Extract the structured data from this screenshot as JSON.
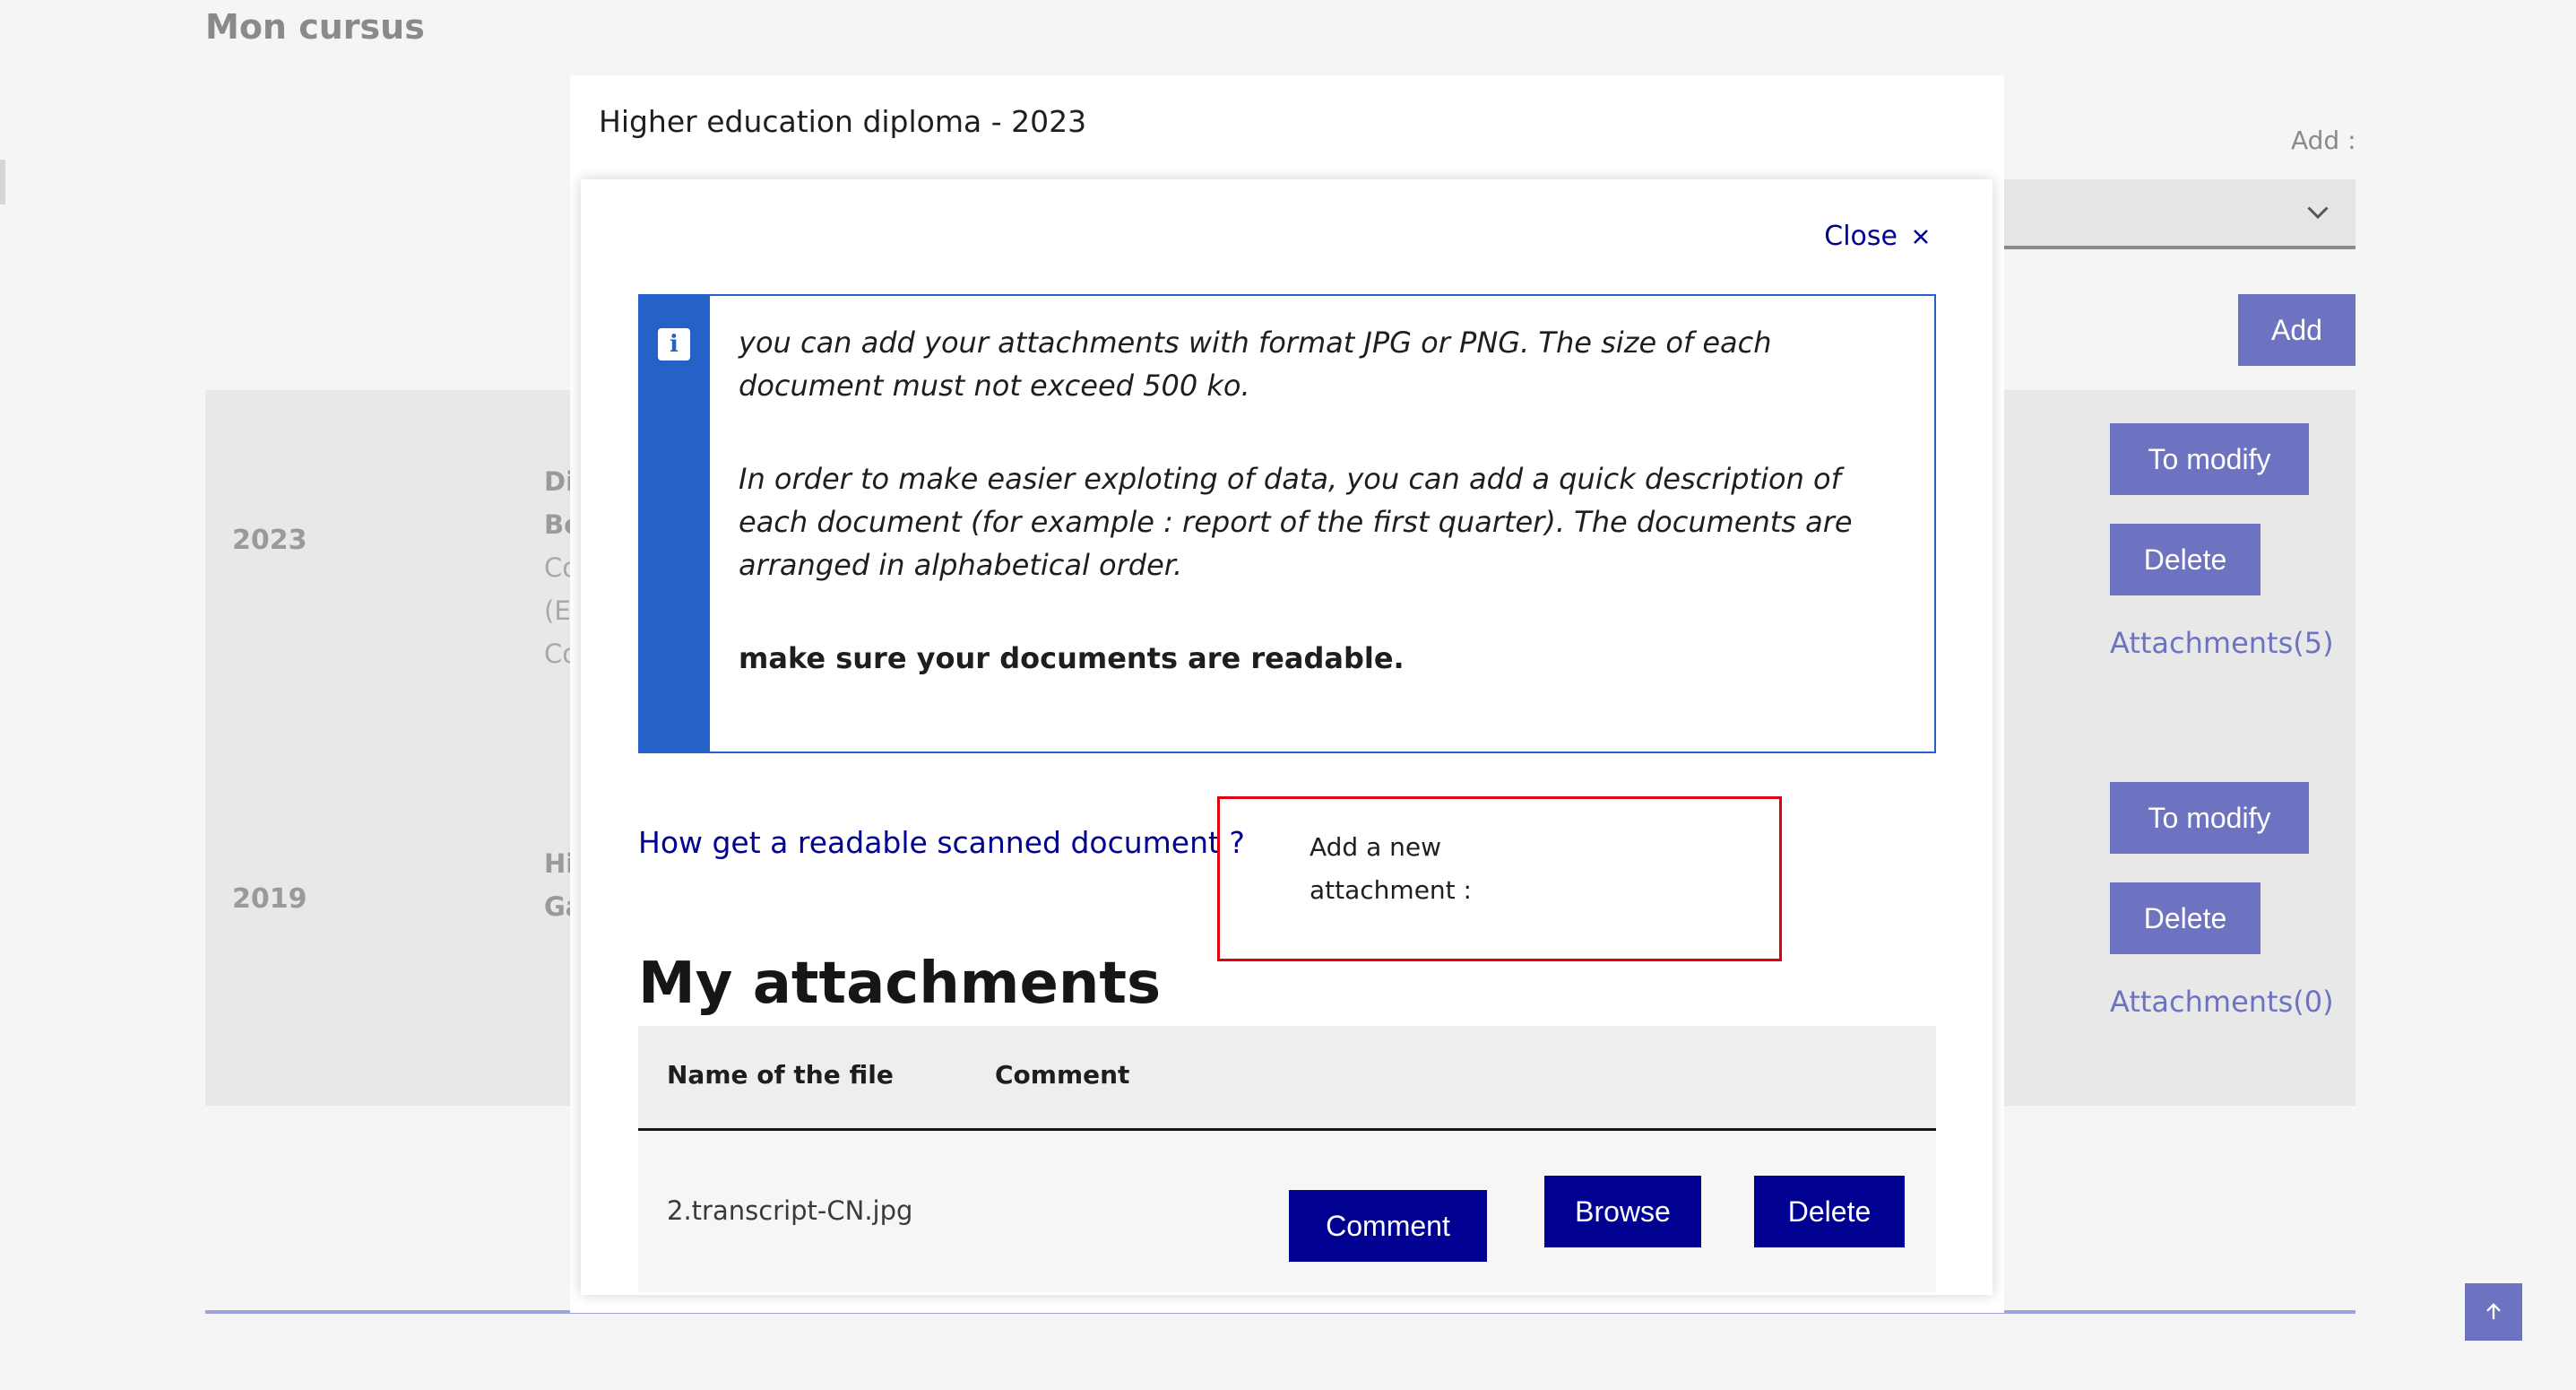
{
  "page": {
    "title": "Mon cursus",
    "add_label": "Add :",
    "add_button": "Add",
    "rows": [
      {
        "year": "2023",
        "fragments": [
          "Di",
          "Be",
          "Co",
          "(Er",
          "Co"
        ],
        "modify": "To modify",
        "delete": "Delete",
        "attachments": "Attachments(5)"
      },
      {
        "year": "2019",
        "fragments": [
          "Hi",
          "Ga"
        ],
        "modify": "To modify",
        "delete": "Delete",
        "attachments": "Attachments(0)"
      }
    ]
  },
  "modal": {
    "outer_title": "Higher education diploma - 2023",
    "close_label": "Close",
    "info": {
      "p1": "you can add your attachments with format JPG or PNG. The size of each document must not exceed 500 ko.",
      "p2": "In order to make easier exploting of data, you can add a quick description of each document (for example : report of the first quarter). The documents are arranged in alphabetical order.",
      "p3": "make sure your documents are readable."
    },
    "help_link": "How get a readable scanned document ?",
    "new_attachment_label": "Add a new attachment :",
    "attachments_heading": "My attachments",
    "table": {
      "col_name": "Name of the file",
      "col_comment": "Comment",
      "rows": [
        {
          "file": "2.transcript-CN.jpg",
          "comment_btn": "Comment",
          "browse_btn": "Browse",
          "delete_btn": "Delete"
        }
      ]
    }
  },
  "colors": {
    "primary": "#000091",
    "info_blue": "#2562c8",
    "muted_purple": "#6e73c1",
    "error_red": "#e1000f"
  }
}
